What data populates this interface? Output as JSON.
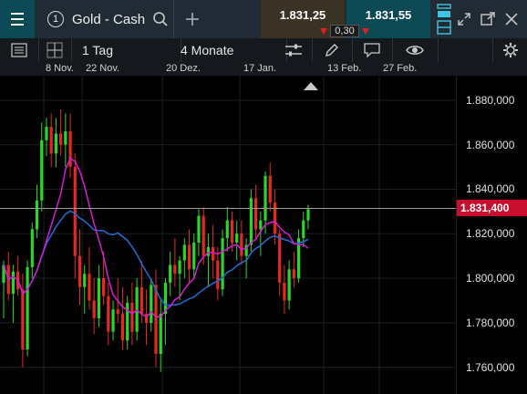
{
  "header": {
    "instrument_number": "1",
    "instrument_name": "Gold - Cash",
    "sell_price": "1.831,25",
    "buy_price": "1.831,55",
    "spread": "0,30"
  },
  "toolbar": {
    "interval": "1 Tag",
    "period": "4 Monate"
  },
  "colors": {
    "up": "#2bd62b",
    "down": "#e8281f",
    "ma_fast": "#d81bd8",
    "ma_slow": "#1e6fd8",
    "price_line": "#9a9a9a",
    "current_price_bg": "#c8102e",
    "sell_bg": "#3b3226",
    "buy_bg": "#0b4a55"
  },
  "chart_data": {
    "type": "candlestick",
    "x_tick_labels": [
      "8 Nov.",
      "22 Nov.",
      "20 Dez.",
      "17 Jan.",
      "13 Feb.",
      "27 Feb."
    ],
    "y_tick_labels": [
      "1.880,000",
      "1.860,000",
      "1.840,000",
      "1.820,000",
      "1.800,000",
      "1.780,000",
      "1.760,000"
    ],
    "y_ticks": [
      1880,
      1860,
      1840,
      1820,
      1800,
      1780,
      1760
    ],
    "ylim": [
      1748,
      1891
    ],
    "current_price": 1831.4,
    "current_price_label": "1.831,400",
    "candles": [
      [
        1798,
        1808,
        1782,
        1806
      ],
      [
        1806,
        1812,
        1790,
        1793
      ],
      [
        1793,
        1806,
        1780,
        1803
      ],
      [
        1803,
        1810,
        1792,
        1795
      ],
      [
        1795,
        1802,
        1760,
        1768
      ],
      [
        1768,
        1808,
        1765,
        1805
      ],
      [
        1805,
        1825,
        1800,
        1822
      ],
      [
        1822,
        1842,
        1818,
        1835
      ],
      [
        1835,
        1870,
        1830,
        1862
      ],
      [
        1862,
        1872,
        1855,
        1868
      ],
      [
        1868,
        1874,
        1850,
        1856
      ],
      [
        1856,
        1872,
        1850,
        1865
      ],
      [
        1865,
        1876,
        1855,
        1860
      ],
      [
        1860,
        1874,
        1850,
        1866
      ],
      [
        1866,
        1874,
        1845,
        1850
      ],
      [
        1850,
        1856,
        1800,
        1810
      ],
      [
        1810,
        1822,
        1788,
        1796
      ],
      [
        1796,
        1806,
        1784,
        1802
      ],
      [
        1802,
        1814,
        1786,
        1790
      ],
      [
        1790,
        1800,
        1775,
        1782
      ],
      [
        1782,
        1806,
        1778,
        1800
      ],
      [
        1800,
        1812,
        1788,
        1792
      ],
      [
        1792,
        1798,
        1770,
        1776
      ],
      [
        1776,
        1790,
        1772,
        1786
      ],
      [
        1786,
        1800,
        1780,
        1784
      ],
      [
        1784,
        1796,
        1768,
        1772
      ],
      [
        1772,
        1792,
        1768,
        1789
      ],
      [
        1789,
        1798,
        1770,
        1776
      ],
      [
        1776,
        1800,
        1772,
        1796
      ],
      [
        1796,
        1808,
        1780,
        1784
      ],
      [
        1784,
        1795,
        1770,
        1780
      ],
      [
        1780,
        1800,
        1776,
        1797
      ],
      [
        1797,
        1804,
        1760,
        1766
      ],
      [
        1766,
        1790,
        1758,
        1784
      ],
      [
        1784,
        1800,
        1770,
        1798
      ],
      [
        1798,
        1812,
        1792,
        1806
      ],
      [
        1806,
        1818,
        1796,
        1802
      ],
      [
        1802,
        1810,
        1790,
        1808
      ],
      [
        1808,
        1818,
        1800,
        1815
      ],
      [
        1815,
        1822,
        1798,
        1804
      ],
      [
        1804,
        1820,
        1800,
        1816
      ],
      [
        1816,
        1831,
        1810,
        1828
      ],
      [
        1828,
        1832,
        1806,
        1810
      ],
      [
        1810,
        1820,
        1796,
        1814
      ],
      [
        1814,
        1824,
        1800,
        1808
      ],
      [
        1808,
        1814,
        1790,
        1795
      ],
      [
        1795,
        1822,
        1792,
        1818
      ],
      [
        1818,
        1832,
        1812,
        1826
      ],
      [
        1826,
        1830,
        1812,
        1816
      ],
      [
        1816,
        1826,
        1808,
        1820
      ],
      [
        1820,
        1826,
        1806,
        1810
      ],
      [
        1810,
        1818,
        1800,
        1815
      ],
      [
        1815,
        1840,
        1812,
        1836
      ],
      [
        1836,
        1842,
        1818,
        1822
      ],
      [
        1822,
        1830,
        1810,
        1826
      ],
      [
        1826,
        1848,
        1820,
        1846
      ],
      [
        1846,
        1852,
        1830,
        1834
      ],
      [
        1834,
        1840,
        1815,
        1820
      ],
      [
        1820,
        1822,
        1792,
        1798
      ],
      [
        1798,
        1806,
        1784,
        1790
      ],
      [
        1790,
        1808,
        1786,
        1804
      ],
      [
        1804,
        1812,
        1796,
        1800
      ],
      [
        1800,
        1822,
        1798,
        1818
      ],
      [
        1818,
        1830,
        1814,
        1826
      ],
      [
        1826,
        1833,
        1822,
        1831
      ]
    ]
  }
}
